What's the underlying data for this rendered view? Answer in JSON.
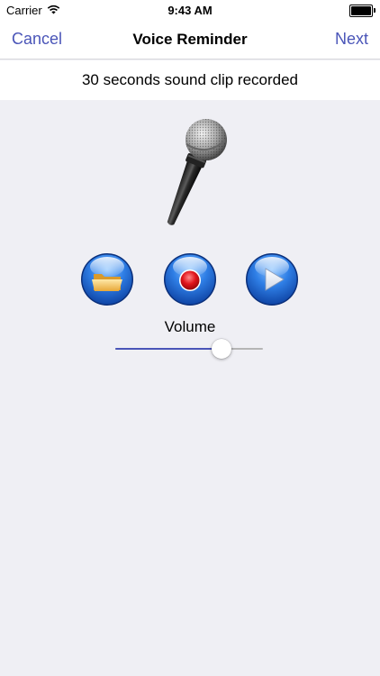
{
  "status_bar": {
    "carrier": "Carrier",
    "time": "9:43 AM",
    "wifi_icon": "wifi-icon",
    "battery_icon": "battery-icon"
  },
  "nav": {
    "cancel_label": "Cancel",
    "title": "Voice Reminder",
    "next_label": "Next"
  },
  "message": "30 seconds sound clip recorded",
  "icons": {
    "microphone": "microphone-icon",
    "folder": "folder-icon",
    "record": "record-icon",
    "play": "play-icon"
  },
  "volume": {
    "label": "Volume",
    "level": 0.72
  },
  "colors": {
    "accent": "#4a55b8",
    "background": "#efeff4",
    "button_blue": "#1f6fd6",
    "record_red": "#e0141b"
  }
}
